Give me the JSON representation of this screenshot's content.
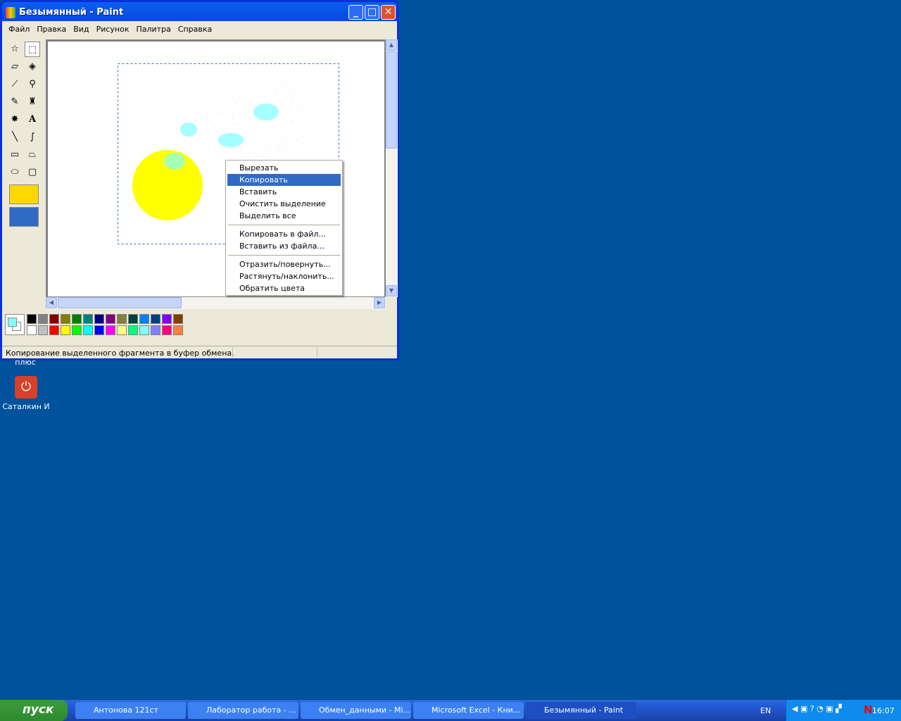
{
  "window": {
    "title": "Безымянный - Paint"
  },
  "menubar": [
    "Файл",
    "Правка",
    "Вид",
    "Рисунок",
    "Палитра",
    "Справка"
  ],
  "context_menu": {
    "items": [
      "Вырезать",
      "Копировать",
      "Вставить",
      "Очистить выделение",
      "Выделить все",
      "Копировать в файл...",
      "Вставить из файла...",
      "Отразить/повернуть...",
      "Растянуть/наклонить...",
      "Обратить цвета"
    ],
    "highlighted": "Копировать"
  },
  "palette": {
    "top": [
      "#000000",
      "#808080",
      "#800000",
      "#808000",
      "#008000",
      "#008080",
      "#000080",
      "#800080",
      "#808040",
      "#004040",
      "#0080ff",
      "#004080",
      "#8000ff",
      "#804000"
    ],
    "bottom": [
      "#ffffff",
      "#c0c0c0",
      "#ff0000",
      "#ffff00",
      "#00ff00",
      "#00ffff",
      "#0000ff",
      "#ff00ff",
      "#ffff80",
      "#00ff80",
      "#80ffff",
      "#8080ff",
      "#ff0080",
      "#ff8040"
    ],
    "foreground": "#80ffff",
    "background": "#ffffff"
  },
  "status": {
    "text": "Копирование выделенного фрагмента в буфер обмена."
  },
  "desktop": {
    "icons": [
      {
        "label": "плюс"
      },
      {
        "label": "Саталкин И"
      }
    ]
  },
  "taskbar": {
    "start": "пуск",
    "tasks": [
      "Антонова 121ст",
      "Лаборатор работа - ...",
      "Обмен_данными - Mi...",
      "Microsoft Excel - Кни...",
      "Безымянный - Paint"
    ],
    "lang": "EN",
    "clock": "16:07"
  }
}
